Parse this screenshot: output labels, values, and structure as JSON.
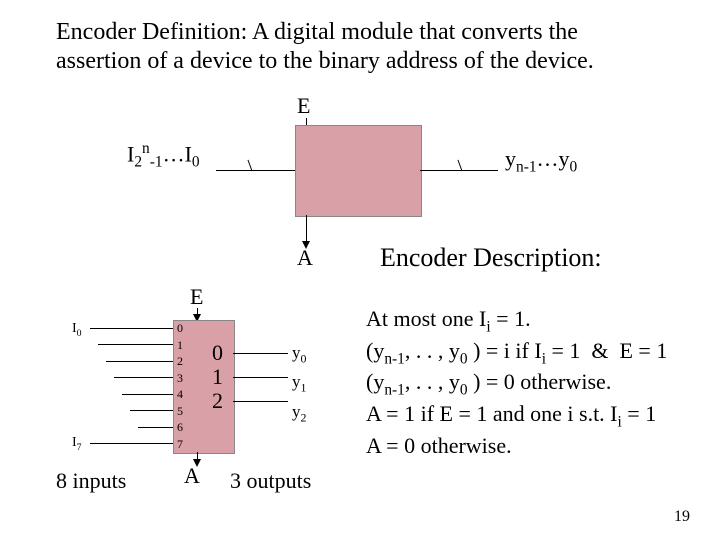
{
  "definition": "Encoder Definition: A digital module that converts the assertion of a device to the binary address of the device.",
  "abstract": {
    "enable_label": "E",
    "active_label": "A",
    "inputs_html": "I<span class='sub'>2</span><span class='sup'>n</span><span class='sub'>-1</span>…I<span class='sub'>0</span>",
    "outputs_html": "y<span class='sub'>n-1</span>…y<span class='sub'>0</span>"
  },
  "enc": {
    "enable_label": "E",
    "active_label": "A",
    "in_numbers": [
      "0",
      "1",
      "2",
      "3",
      "4",
      "5",
      "6",
      "7"
    ],
    "out_numbers": [
      "0",
      "1",
      "2"
    ],
    "i0": "I",
    "i0_sub": "0",
    "i7": "I",
    "i7_sub": "7",
    "y_labels_html": [
      "y<span class='sub'>0</span>",
      "y<span class='sub'>1</span>",
      "y<span class='sub'>2</span>"
    ],
    "eight_inputs": "8 inputs",
    "three_outputs": "3 outputs"
  },
  "description": {
    "title": "Encoder Description:",
    "lines_html": [
      "At most one I<span class='sub'>i</span> = 1.",
      "(y<span class='sub'>n-1</span>, . . , y<span class='sub'>0</span> ) = i if I<span class='sub'>i</span> = 1 &nbsp;&amp;&nbsp; E = 1",
      "(y<span class='sub'>n-1</span>, . . , y<span class='sub'>0</span> ) = 0 otherwise.",
      "A = 1 if E = 1 and one i s.t. I<span class='sub'>i</span> = 1",
      "A = 0 otherwise."
    ]
  },
  "page_number": "19"
}
